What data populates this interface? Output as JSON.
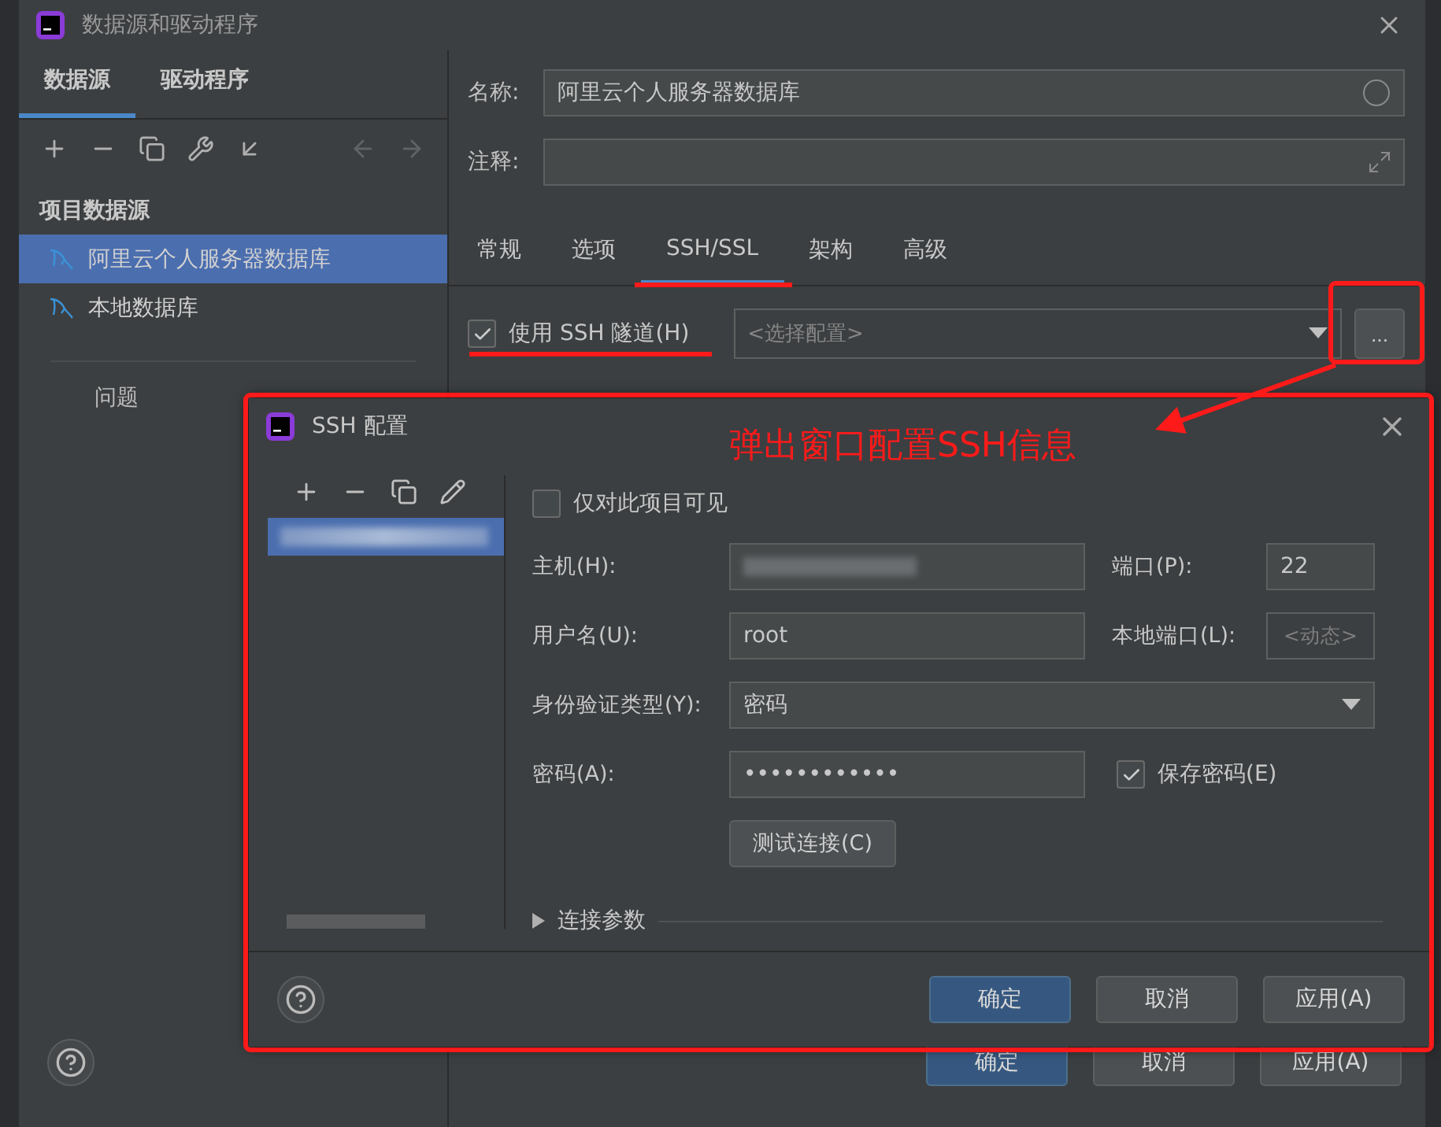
{
  "window": {
    "title": "数据源和驱动程序"
  },
  "left_tabs": [
    {
      "label": "数据源",
      "selected": true
    },
    {
      "label": "驱动程序",
      "selected": false
    }
  ],
  "section_title": "项目数据源",
  "data_sources": [
    {
      "label": "阿里云个人服务器数据库",
      "selected": true
    },
    {
      "label": "本地数据库",
      "selected": false
    }
  ],
  "problems_label": "问题",
  "name_field": {
    "label": "名称:",
    "value": "阿里云个人服务器数据库"
  },
  "comment_field": {
    "label": "注释:"
  },
  "tabs": [
    {
      "label": "常规",
      "selected": false
    },
    {
      "label": "选项",
      "selected": false
    },
    {
      "label": "SSH/SSL",
      "selected": true
    },
    {
      "label": "架构",
      "selected": false
    },
    {
      "label": "高级",
      "selected": false
    }
  ],
  "ssh_tunnel": {
    "label": "使用 SSH 隧道(H)",
    "checked": true,
    "config_placeholder": "<选择配置>",
    "more_button": "..."
  },
  "buttons": [
    {
      "label": "确定",
      "primary": true
    },
    {
      "label": "取消",
      "primary": false
    },
    {
      "label": "应用(A)",
      "primary": false
    }
  ],
  "annotation": {
    "text": "弹出窗口配置SSH信息"
  },
  "ssh_dialog": {
    "title": "SSH 配置",
    "project_only": {
      "label": "仅对此项目可见",
      "checked": false
    },
    "host": {
      "label": "主机(H):"
    },
    "port": {
      "label": "端口(P):",
      "value": "22"
    },
    "user": {
      "label": "用户名(U):",
      "value": "root"
    },
    "local_port": {
      "label": "本地端口(L):",
      "placeholder": "<动态>"
    },
    "auth_type": {
      "label": "身份验证类型(Y):",
      "value": "密码"
    },
    "password": {
      "label": "密码(A):",
      "value": "••••••••••••"
    },
    "save_password": {
      "label": "保存密码(E)",
      "checked": true
    },
    "test_button": "测试连接(C)",
    "connection_params": "连接参数",
    "buttons": [
      {
        "label": "确定",
        "primary": true
      },
      {
        "label": "取消",
        "primary": false
      },
      {
        "label": "应用(A)",
        "primary": false
      }
    ]
  }
}
